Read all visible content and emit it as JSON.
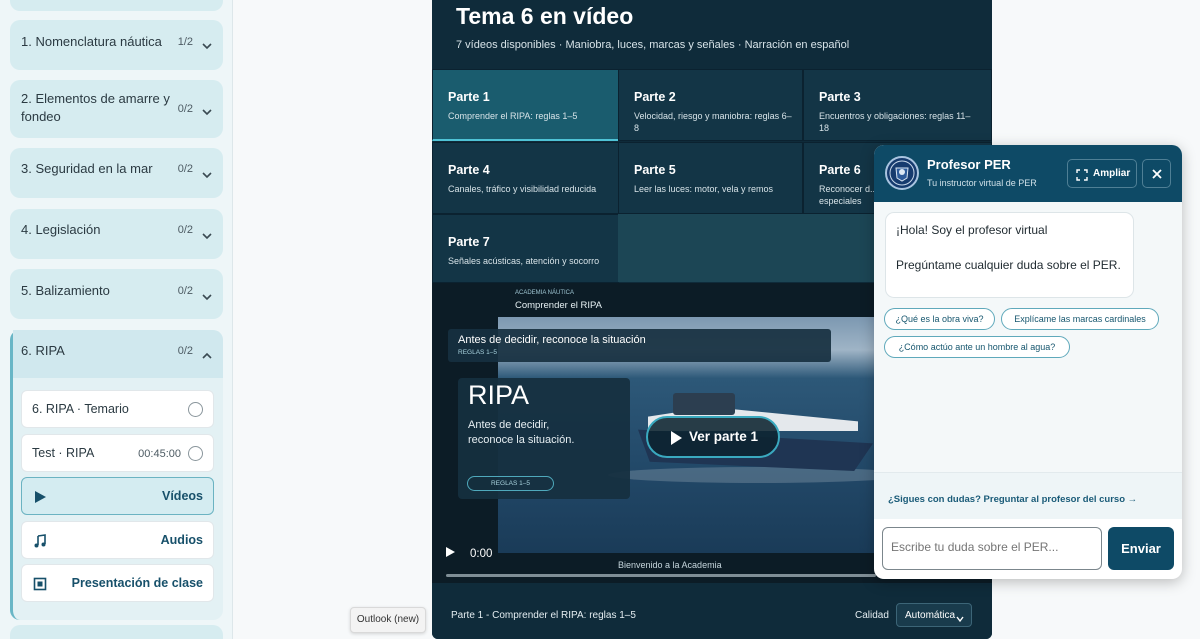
{
  "sidebar": {
    "modules": [
      {
        "title": "1. Nomenclatura náutica",
        "count": "1/2"
      },
      {
        "title": "2. Elementos de amarre y fondeo",
        "count": "0/2"
      },
      {
        "title": "3. Seguridad en la mar",
        "count": "0/2"
      },
      {
        "title": "4. Legislación",
        "count": "0/2"
      },
      {
        "title": "5. Balizamiento",
        "count": "0/2"
      }
    ],
    "open_module": {
      "title": "6. RIPA",
      "count": "0/2",
      "items": [
        {
          "label": "6. RIPA · Temario"
        },
        {
          "label": "Test · RIPA",
          "meta": "00:45:00"
        }
      ],
      "resources": [
        {
          "label": "Vídeos",
          "icon": "play-icon"
        },
        {
          "label": "Audios",
          "icon": "music-note-icon"
        },
        {
          "label": "Presentación de clase",
          "icon": "slides-icon"
        }
      ]
    }
  },
  "panel": {
    "title": "Tema 6 en vídeo",
    "subtitle": "7 vídeos disponibles · Maniobra, luces, marcas y señales · Narración en español",
    "parts": [
      {
        "title": "Parte 1",
        "desc": "Comprender el RIPA: reglas 1–5"
      },
      {
        "title": "Parte 2",
        "desc": "Velocidad, riesgo y maniobra: reglas 6–8"
      },
      {
        "title": "Parte 3",
        "desc": "Encuentros y obligaciones: reglas 11–18"
      },
      {
        "title": "Parte 4",
        "desc": "Canales, tráfico y visibilidad reducida"
      },
      {
        "title": "Parte 5",
        "desc": "Leer las luces: motor, vela y remos"
      },
      {
        "title": "Parte 6",
        "desc": "Reconocer d... especiales"
      },
      {
        "title": "Parte 7",
        "desc": "Señales acústicas, atención y socorro"
      }
    ],
    "video": {
      "brand": "ACADEMIA NÁUTICA",
      "header": "Comprender el RIPA",
      "situ_title": "Antes de decidir, reconoce la situación",
      "situ_tag": "REGLAS 1–5",
      "big_title": "RIPA",
      "big_text": "Antes de decidir, reconoce la situación.",
      "pill": "REGLAS 1–5",
      "play_label": "Ver parte 1",
      "time": "0:00",
      "caption": "Bienvenido a la Academia"
    },
    "footer": {
      "now_playing": "Parte 1 - Comprender el RIPA: reglas 1–5",
      "quality_label": "Calidad",
      "quality_value": "Automática"
    }
  },
  "tooltip": "Outlook (new)",
  "chat": {
    "name": "Profesor PER",
    "role": "Tu instructor virtual de PER",
    "expand_label": "Ampliar",
    "greeting": "¡Hola! Soy el profesor virtual",
    "prompt": "Pregúntame cualquier duda sobre el PER.",
    "suggestions": [
      "¿Qué es la obra viva?",
      "Explícame las marcas cardinales",
      "¿Cómo actúo ante un hombre al agua?"
    ],
    "course_link": "¿Sigues con dudas? Preguntar al profesor del curso →",
    "input_placeholder": "Escribe tu duda sobre el PER...",
    "send_label": "Enviar"
  }
}
